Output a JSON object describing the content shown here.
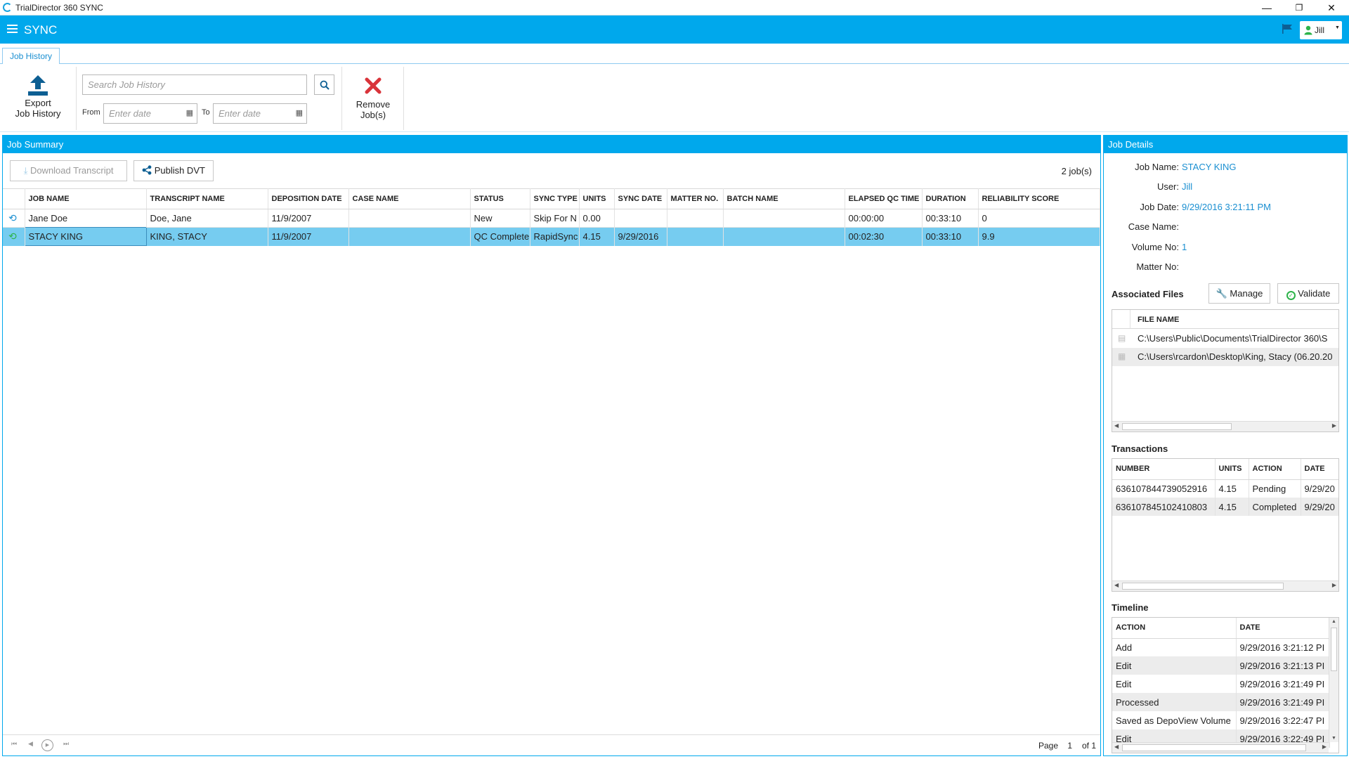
{
  "window": {
    "title": "TrialDirector 360 SYNC",
    "minimize": "—",
    "maximize": "❐",
    "close": "✕"
  },
  "header": {
    "brand": "SYNC",
    "user": "Jill"
  },
  "ribbon": {
    "tab": "Job History",
    "export_label_1": "Export",
    "export_label_2": "Job History",
    "search_placeholder": "Search Job History",
    "from_label": "From",
    "to_label": "To",
    "date_placeholder": "Enter date",
    "remove_label_1": "Remove",
    "remove_label_2": "Job(s)"
  },
  "job_summary": {
    "title": "Job Summary",
    "download_label": "Download Transcript",
    "publish_label": "Publish DVT",
    "count": "2 job(s)",
    "columns": [
      "JOB NAME",
      "TRANSCRIPT NAME",
      "DEPOSITION DATE",
      "CASE NAME",
      "STATUS",
      "SYNC TYPE",
      "UNITS",
      "SYNC DATE",
      "MATTER NO.",
      "BATCH NAME",
      "ELAPSED QC TIME",
      "DURATION",
      "RELIABILITY SCORE"
    ],
    "rows": [
      [
        "Jane Doe",
        "Doe, Jane",
        "11/9/2007",
        "",
        "New",
        "Skip For N",
        "0.00",
        "",
        "",
        "",
        "00:00:00",
        "00:33:10",
        "0"
      ],
      [
        "STACY KING",
        "KING, STACY",
        "11/9/2007",
        "",
        "QC Complete",
        "RapidSync",
        "4.15",
        "9/29/2016",
        "",
        "",
        "00:02:30",
        "00:33:10",
        "9.9"
      ]
    ],
    "pager": {
      "page_label": "Page",
      "page": "1",
      "of": "of 1"
    }
  },
  "job_details": {
    "title": "Job Details",
    "job_name_label": "Job Name:",
    "job_name": "STACY KING",
    "user_label": "User:",
    "user": "Jill",
    "job_date_label": "Job Date:",
    "job_date": "9/29/2016 3:21:11 PM",
    "case_name_label": "Case Name:",
    "case_name": "",
    "volume_label": "Volume No:",
    "volume": "1",
    "matter_label": "Matter No:",
    "matter": "",
    "associated_files_title": "Associated Files",
    "manage_label": "Manage",
    "validate_label": "Validate",
    "files_column": "FILE NAME",
    "files": [
      "C:\\Users\\Public\\Documents\\TrialDirector 360\\S",
      "C:\\Users\\rcardon\\Desktop\\King, Stacy (06.20.20"
    ],
    "transactions_title": "Transactions",
    "transactions_columns": [
      "NUMBER",
      "UNITS",
      "ACTION",
      "DATE"
    ],
    "transactions": [
      [
        "636107844739052916",
        "4.15",
        "Pending",
        "9/29/20"
      ],
      [
        "636107845102410803",
        "4.15",
        "Completed",
        "9/29/20"
      ]
    ],
    "timeline_title": "Timeline",
    "timeline_columns": [
      "ACTION",
      "DATE"
    ],
    "timeline": [
      [
        "Add",
        "9/29/2016 3:21:12 PI"
      ],
      [
        "Edit",
        "9/29/2016 3:21:13 PI"
      ],
      [
        "Edit",
        "9/29/2016 3:21:49 PI"
      ],
      [
        "Processed",
        "9/29/2016 3:21:49 PI"
      ],
      [
        "Saved as DepoView Volume",
        "9/29/2016 3:22:47 PI"
      ],
      [
        "Edit",
        "9/29/2016 3:22:49 PI"
      ]
    ]
  },
  "colors": {
    "accent": "#00a8ec",
    "selected_row": "#76ccf0",
    "link": "#1a8fd1",
    "remove": "#d9343a",
    "ok": "#2db34a"
  }
}
